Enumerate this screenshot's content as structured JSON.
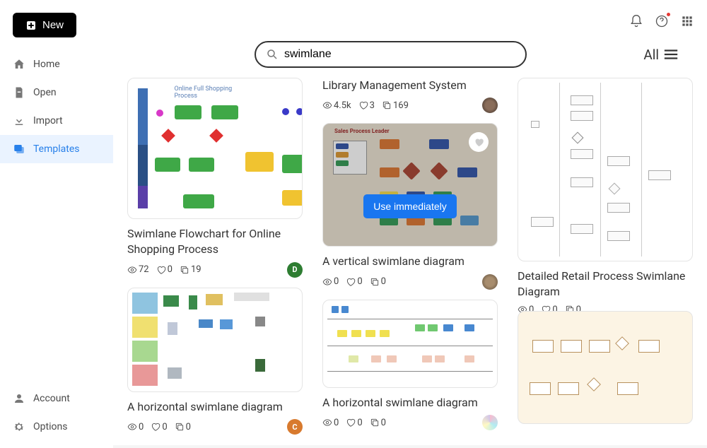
{
  "new_button": "New",
  "nav": {
    "home": "Home",
    "open": "Open",
    "import": "Import",
    "templates": "Templates",
    "account": "Account",
    "options": "Options"
  },
  "search": {
    "value": "swimlane"
  },
  "filter_label": "All",
  "use_button": "Use immediately",
  "cards": {
    "c1": {
      "title": "Swimlane Flowchart for Online Shopping Process",
      "views": "72",
      "likes": "0",
      "copies": "19",
      "thumb_title": "Online Full Shopping Process"
    },
    "c2": {
      "title": "A horizontal swimlane diagram",
      "views": "0",
      "likes": "0",
      "copies": "0"
    },
    "c3": {
      "title": "Library Management System",
      "views": "4.5k",
      "likes": "3",
      "copies": "169"
    },
    "c4": {
      "title": "A vertical swimlane diagram",
      "views": "0",
      "likes": "0",
      "copies": "0",
      "thumb_label": "Sales Process Leader"
    },
    "c5": {
      "title": "A horizontal swimlane diagram",
      "views": "0",
      "likes": "0",
      "copies": "0"
    },
    "c6": {
      "title": "Detailed Retail Process Swimlane Diagram",
      "views": "0",
      "likes": "0",
      "copies": "0"
    }
  }
}
